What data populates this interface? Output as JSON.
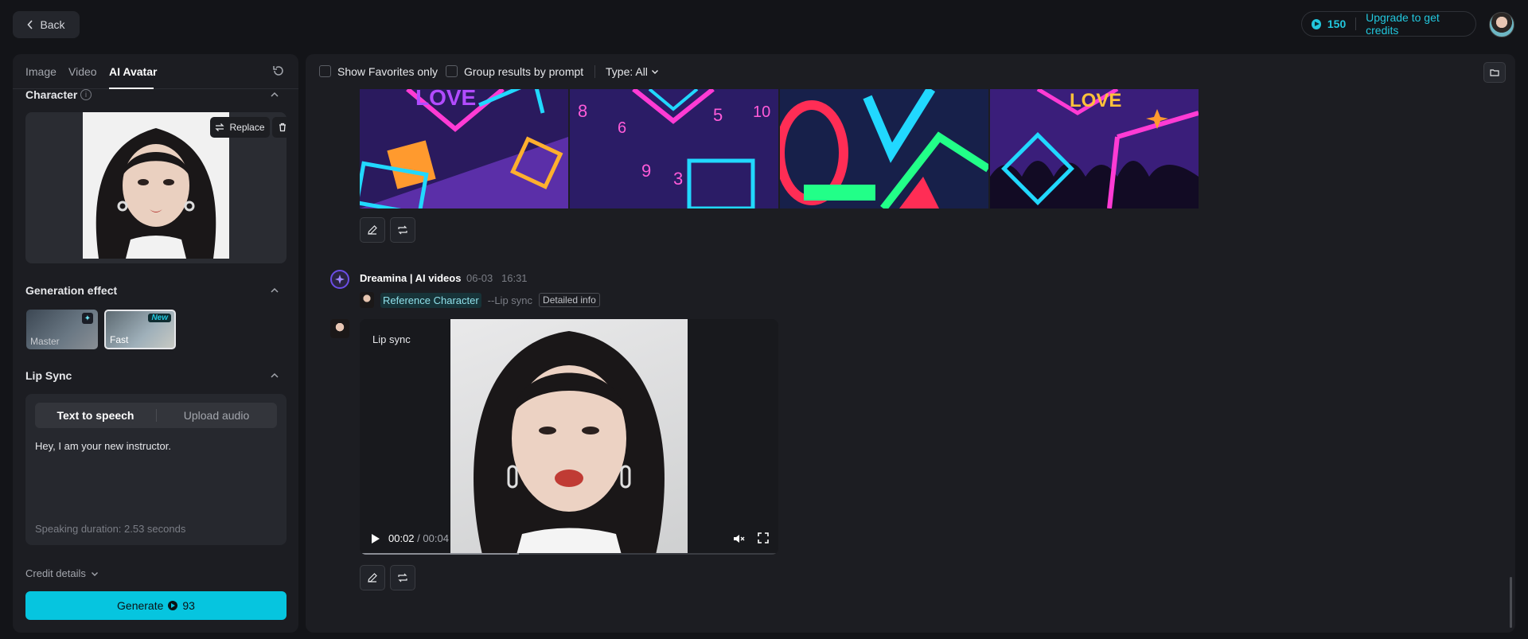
{
  "header": {
    "back_label": "Back",
    "credits_count": "150",
    "upgrade_label": "Upgrade to get credits"
  },
  "sidebar": {
    "tabs": [
      {
        "label": "Image"
      },
      {
        "label": "Video"
      },
      {
        "label": "AI Avatar"
      }
    ],
    "active_tab": "AI Avatar",
    "character": {
      "title": "Character",
      "replace_label": "Replace"
    },
    "generation_effect": {
      "title": "Generation effect",
      "options": [
        {
          "label": "Master"
        },
        {
          "label": "Fast",
          "badge": "New"
        }
      ],
      "selected": "Fast"
    },
    "lip_sync": {
      "title": "Lip Sync",
      "tabs": [
        {
          "label": "Text to speech"
        },
        {
          "label": "Upload audio"
        }
      ],
      "active_tab": "Text to speech",
      "text": "Hey, I am your new instructor.",
      "duration": "Speaking duration: 2.53 seconds"
    },
    "credit_details_label": "Credit details",
    "generate": {
      "label": "Generate",
      "cost": "93"
    }
  },
  "main": {
    "toolbar": {
      "favorites_label": "Show Favorites only",
      "group_label": "Group results by prompt",
      "type_filter_label": "Type: All"
    },
    "message": {
      "title": "Dreamina | AI videos",
      "date": "06-03",
      "time": "16:31",
      "reference_label": "Reference Character",
      "mode_label": "--Lip sync",
      "details_label": "Detailed info"
    },
    "video": {
      "label": "Lip sync",
      "current_time": "00:02",
      "duration": "00:04",
      "progress": 0.38
    }
  },
  "colors": {
    "accent": "#06c5df",
    "background": "#131418",
    "panel": "#1c1d22"
  }
}
